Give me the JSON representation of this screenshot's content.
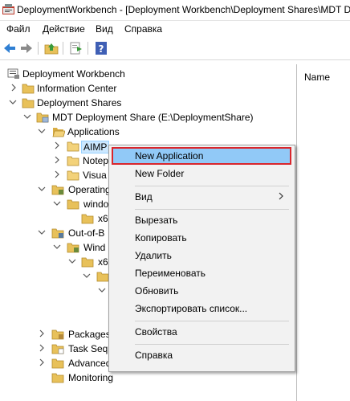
{
  "window": {
    "title": "DeploymentWorkbench - [Deployment Workbench\\Deployment Shares\\MDT D"
  },
  "menu": [
    "Файл",
    "Действие",
    "Вид",
    "Справка"
  ],
  "toolbar": {
    "buttons": [
      "back-arrow-icon",
      "forward-arrow-icon",
      "up-folder-icon",
      "export-icon",
      "help-icon"
    ]
  },
  "tree": {
    "root": "Deployment Workbench",
    "info_center": "Information Center",
    "deployment_shares": "Deployment Shares",
    "mdt_share": "MDT Deployment Share (E:\\DeploymentShare)",
    "applications": "Applications",
    "aimp": "AIMP",
    "notepad": "Notep",
    "visual": "Visua",
    "operating": "Operating",
    "windo": "windo",
    "x6_1": "x6",
    "out_of_box": "Out-of-B",
    "wind": "Wind",
    "x6_2": "x6",
    "packages": "Packages",
    "task_seq": "Task Sequ",
    "advanced": "Advanced",
    "monitoring": "Monitoring"
  },
  "right_pane": {
    "column_header": "Name"
  },
  "context_menu": {
    "items": [
      "New Application",
      "New Folder",
      "Вид",
      "Вырезать",
      "Копировать",
      "Удалить",
      "Переименовать",
      "Обновить",
      "Экспортировать список...",
      "Свойства",
      "Справка"
    ],
    "highlighted": "New Application",
    "highlight_border_color": "#d9262c",
    "highlight_fill_color": "#91c9f7"
  }
}
